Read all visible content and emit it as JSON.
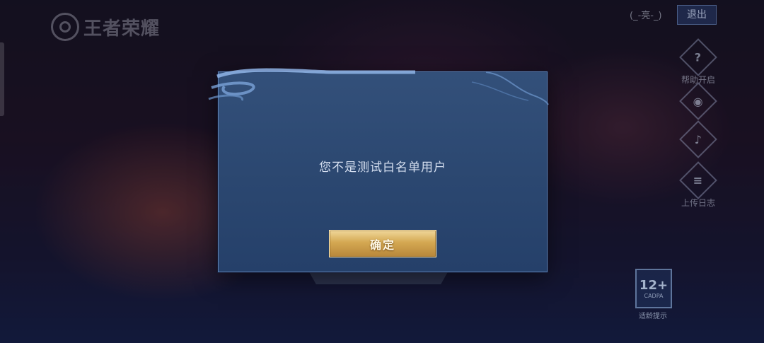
{
  "game": {
    "logo_text": "王者荣耀"
  },
  "header": {
    "user_tag": "(_-亮-_)",
    "quit_label": "退出"
  },
  "side_tools": [
    {
      "icon": "question-icon",
      "glyph": "?",
      "label": "帮助开启"
    },
    {
      "icon": "gamepad-icon",
      "glyph": "◉",
      "label": ""
    },
    {
      "icon": "speaker-icon",
      "glyph": "♪",
      "label": ""
    },
    {
      "icon": "log-icon",
      "glyph": "≡",
      "label": "上传日志"
    }
  ],
  "age_rating": {
    "value": "12+",
    "org": "CADPA",
    "caption": "适龄提示"
  },
  "dialog": {
    "message": "您不是测试白名单用户",
    "confirm_label": "确定"
  },
  "colors": {
    "dialog_bg": "#2b4770",
    "button_gold": "#d4a852",
    "message_text": "#d4deef"
  }
}
